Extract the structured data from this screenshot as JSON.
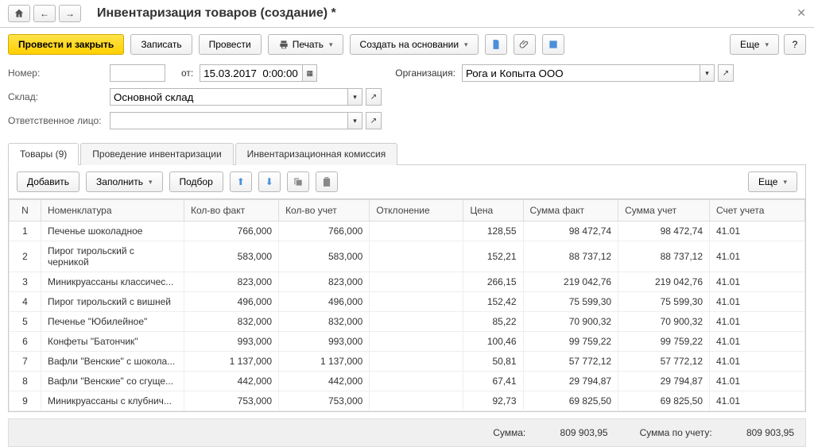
{
  "header": {
    "title": "Инвентаризация товаров (создание) *"
  },
  "toolbar": {
    "post_close": "Провести и закрыть",
    "save": "Записать",
    "post": "Провести",
    "print": "Печать",
    "create_based": "Создать на основании",
    "more": "Еще"
  },
  "form": {
    "number_label": "Номер:",
    "number_value": "",
    "from_label": "от:",
    "date_value": "15.03.2017  0:00:00",
    "org_label": "Организация:",
    "org_value": "Рога и Копыта ООО",
    "warehouse_label": "Склад:",
    "warehouse_value": "Основной склад",
    "responsible_label": "Ответственное лицо:",
    "responsible_value": ""
  },
  "tabs": [
    "Товары (9)",
    "Проведение инвентаризации",
    "Инвентаризационная комиссия"
  ],
  "table_toolbar": {
    "add": "Добавить",
    "fill": "Заполнить",
    "select": "Подбор",
    "more": "Еще"
  },
  "columns": [
    "N",
    "Номенклатура",
    "Кол-во факт",
    "Кол-во учет",
    "Отклонение",
    "Цена",
    "Сумма факт",
    "Сумма учет",
    "Счет учета"
  ],
  "rows": [
    {
      "n": "1",
      "name": "Печенье шоколадное",
      "qf": "766,000",
      "qa": "766,000",
      "dev": "",
      "price": "128,55",
      "sf": "98 472,74",
      "sa": "98 472,74",
      "acc": "41.01"
    },
    {
      "n": "2",
      "name": "Пирог тирольский с черникой",
      "qf": "583,000",
      "qa": "583,000",
      "dev": "",
      "price": "152,21",
      "sf": "88 737,12",
      "sa": "88 737,12",
      "acc": "41.01"
    },
    {
      "n": "3",
      "name": "Миникруассаны классичес...",
      "qf": "823,000",
      "qa": "823,000",
      "dev": "",
      "price": "266,15",
      "sf": "219 042,76",
      "sa": "219 042,76",
      "acc": "41.01"
    },
    {
      "n": "4",
      "name": "Пирог тирольский с вишней",
      "qf": "496,000",
      "qa": "496,000",
      "dev": "",
      "price": "152,42",
      "sf": "75 599,30",
      "sa": "75 599,30",
      "acc": "41.01"
    },
    {
      "n": "5",
      "name": "Печенье \"Юбилейное\"",
      "qf": "832,000",
      "qa": "832,000",
      "dev": "",
      "price": "85,22",
      "sf": "70 900,32",
      "sa": "70 900,32",
      "acc": "41.01"
    },
    {
      "n": "6",
      "name": "Конфеты \"Батончик\"",
      "qf": "993,000",
      "qa": "993,000",
      "dev": "",
      "price": "100,46",
      "sf": "99 759,22",
      "sa": "99 759,22",
      "acc": "41.01"
    },
    {
      "n": "7",
      "name": "Вафли \"Венские\" с шокола...",
      "qf": "1 137,000",
      "qa": "1 137,000",
      "dev": "",
      "price": "50,81",
      "sf": "57 772,12",
      "sa": "57 772,12",
      "acc": "41.01"
    },
    {
      "n": "8",
      "name": "Вафли \"Венские\" со сгуще...",
      "qf": "442,000",
      "qa": "442,000",
      "dev": "",
      "price": "67,41",
      "sf": "29 794,87",
      "sa": "29 794,87",
      "acc": "41.01"
    },
    {
      "n": "9",
      "name": "Миникруассаны с клубнич...",
      "qf": "753,000",
      "qa": "753,000",
      "dev": "",
      "price": "92,73",
      "sf": "69 825,50",
      "sa": "69 825,50",
      "acc": "41.01"
    }
  ],
  "footer": {
    "sum_label": "Сумма:",
    "sum_value": "809 903,95",
    "sum_acc_label": "Сумма по учету:",
    "sum_acc_value": "809 903,95"
  }
}
